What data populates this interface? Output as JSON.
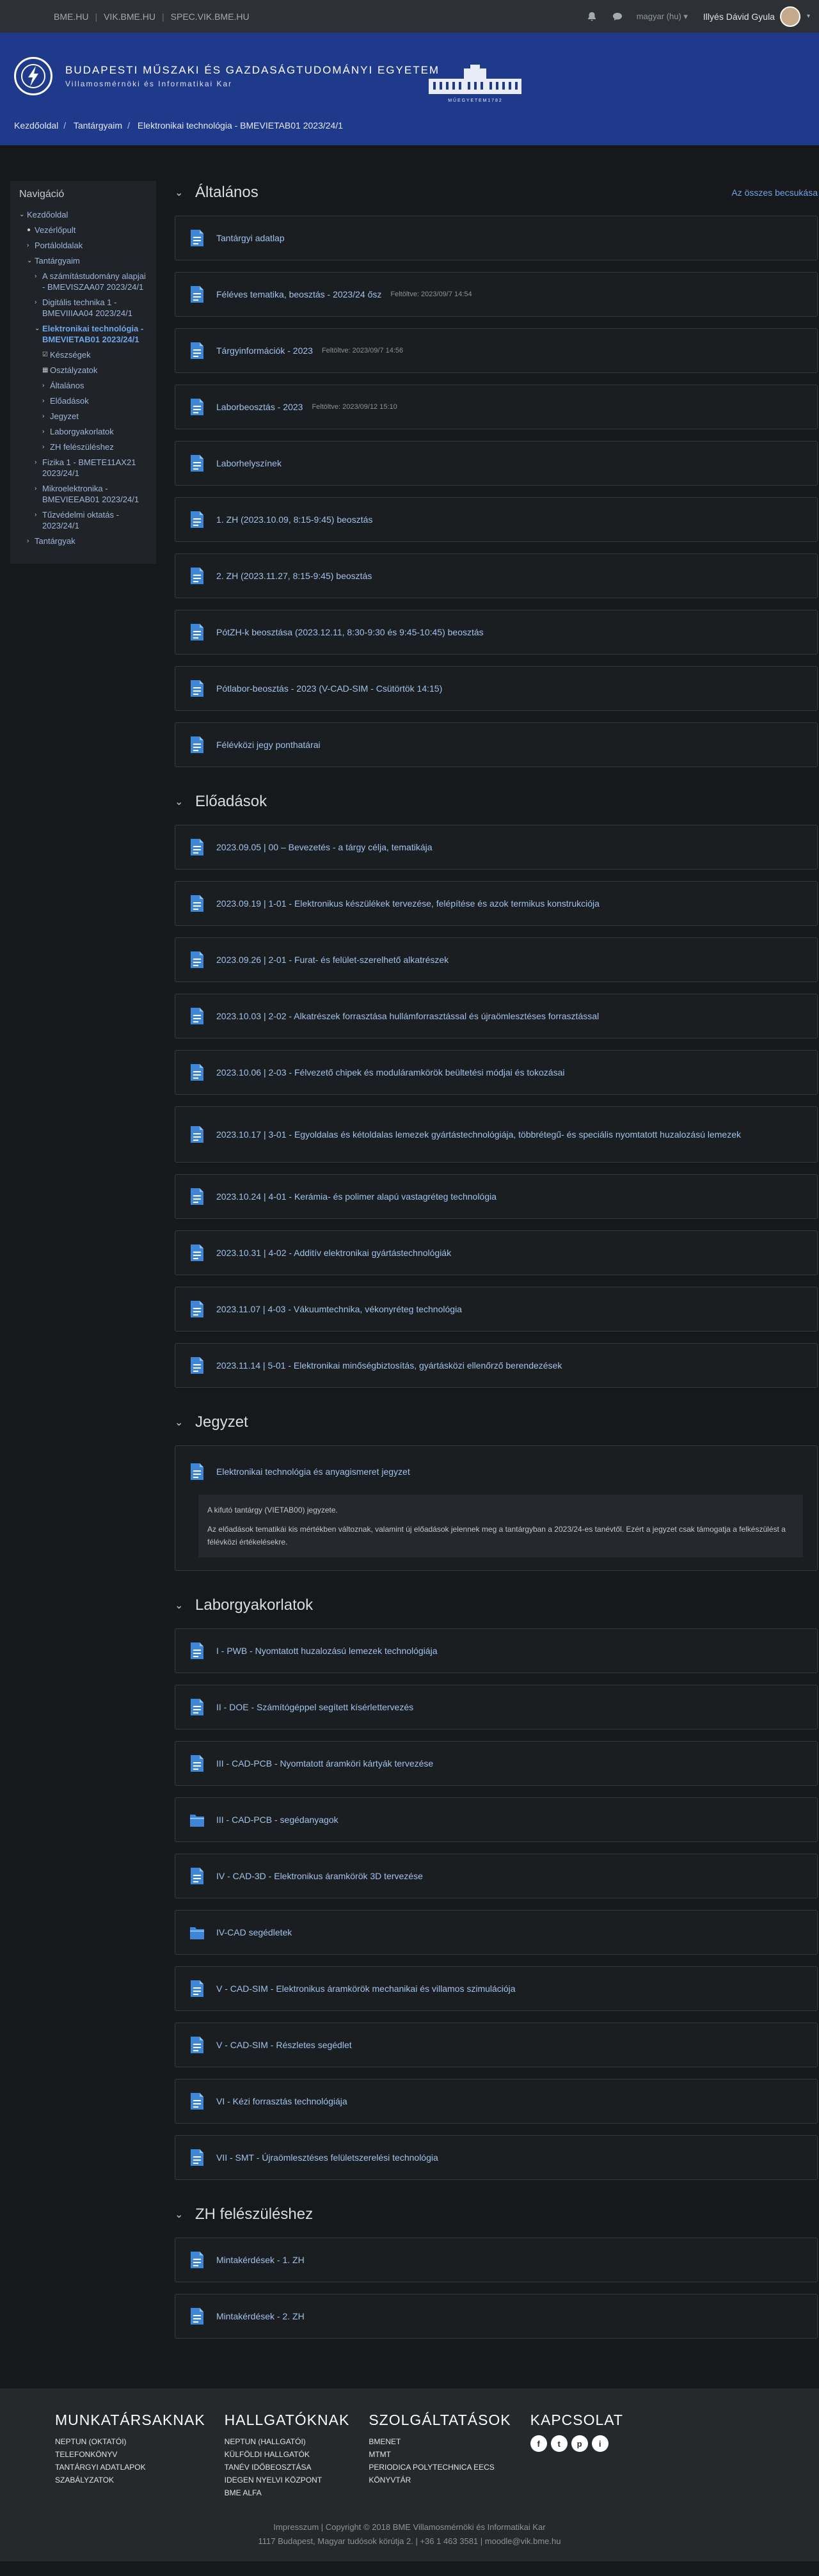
{
  "topbar": {
    "links": [
      "BME.HU",
      "VIK.BME.HU",
      "SPEC.VIK.BME.HU"
    ],
    "lang": "magyar (hu)",
    "user": "Illyés Dávid Gyula"
  },
  "banner": {
    "name1": "BUDAPESTI MŰSZAKI ÉS GAZDASÁGTUDOMÁNYI EGYETEM",
    "name2": "Villamosmérnöki és Informatikai Kar",
    "building_caption": "M Ű E G Y E T E M   1 7 8 2"
  },
  "breadcrumb": [
    "Kezdőoldal",
    "Tantárgyaim",
    "Elektronikai technológia - BMEVIETAB01 2023/24/1"
  ],
  "sidebar": {
    "title": "Navigáció",
    "items": [
      {
        "label": "Kezdőoldal",
        "indent": 0,
        "caret": "v"
      },
      {
        "label": "Vezérlőpult",
        "indent": 1,
        "caret": "o"
      },
      {
        "label": "Portáloldalak",
        "indent": 1,
        "caret": ">"
      },
      {
        "label": "Tantárgyaim",
        "indent": 1,
        "caret": "v"
      },
      {
        "label": "A számítástudomány alapjai - BMEVISZAA07 2023/24/1",
        "indent": 2,
        "caret": ">"
      },
      {
        "label": "Digitális technika 1 - BMEVIIIAA04 2023/24/1",
        "indent": 2,
        "caret": ">"
      },
      {
        "label": "Elektronikai technológia - BMEVIETAB01 2023/24/1",
        "indent": 2,
        "caret": "v",
        "active": true
      },
      {
        "label": "Készségek",
        "indent": 3,
        "caret": "k"
      },
      {
        "label": "Osztályzatok",
        "indent": 3,
        "caret": "g"
      },
      {
        "label": "Általános",
        "indent": 3,
        "caret": ">"
      },
      {
        "label": "Előadások",
        "indent": 3,
        "caret": ">"
      },
      {
        "label": "Jegyzet",
        "indent": 3,
        "caret": ">"
      },
      {
        "label": "Laborgyakorlatok",
        "indent": 3,
        "caret": ">"
      },
      {
        "label": "ZH felészüléshez",
        "indent": 3,
        "caret": ">"
      },
      {
        "label": "Fizika 1 - BMETE11AX21 2023/24/1",
        "indent": 2,
        "caret": ">"
      },
      {
        "label": "Mikroelektronika - BMEVIEEAB01 2023/24/1",
        "indent": 2,
        "caret": ">"
      },
      {
        "label": "Tűzvédelmi oktatás - 2023/24/1",
        "indent": 2,
        "caret": ">"
      },
      {
        "label": "Tantárgyak",
        "indent": 1,
        "caret": ">"
      }
    ]
  },
  "sections": {
    "general": {
      "title": "Általános",
      "collapse_all": "Az összes becsukása",
      "items": [
        {
          "label": "Tantárgyi adatlap",
          "updated": ""
        },
        {
          "label": "Féléves tematika, beosztás - 2023/24 ősz",
          "updated": "Feltöltve: 2023/09/7 14:54"
        },
        {
          "label": "Tárgyinformációk - 2023",
          "updated": "Feltöltve: 2023/09/7 14:56"
        },
        {
          "label": "Laborbeosztás - 2023",
          "updated": "Feltöltve: 2023/09/12 15:10"
        },
        {
          "label": "Laborhelyszínek",
          "updated": ""
        },
        {
          "label": "1. ZH (2023.10.09, 8:15-9:45) beosztás",
          "updated": ""
        },
        {
          "label": "2. ZH (2023.11.27, 8:15-9:45) beosztás",
          "updated": ""
        },
        {
          "label": "PótZH-k beosztása (2023.12.11, 8:30-9:30 és 9:45-10:45) beosztás",
          "updated": ""
        },
        {
          "label": "Pótlabor-beosztás - 2023 (V-CAD-SIM - Csütörtök 14:15)",
          "updated": ""
        },
        {
          "label": "Félévközi jegy ponthatárai",
          "updated": ""
        }
      ]
    },
    "lectures": {
      "title": "Előadások",
      "items": [
        "2023.09.05 | 00 – Bevezetés - a tárgy célja, tematikája",
        "2023.09.19 | 1-01 - Elektronikus készülékek tervezése, felépítése és azok termikus konstrukciója",
        "2023.09.26 | 2-01 - Furat- és felület-szerelhető alkatrészek",
        "2023.10.03 | 2-02 - Alkatrészek forrasztása hullámforrasztással és újraömlesztéses forrasztással",
        "2023.10.06 | 2-03 - Félvezető chipek és moduláramkörök beültetési módjai és tokozásai",
        "2023.10.17 | 3-01 - Egyoldalas és kétoldalas lemezek gyártástechnológiája, többrétegű- és speciális nyomtatott huzalozású lemezek",
        "2023.10.24 | 4-01 - Kerámia- és polimer alapú vastagréteg technológia",
        "2023.10.31 | 4-02 - Additív elektronikai gyártástechnológiák",
        "2023.11.07 | 4-03 - Vákuumtechnika, vékonyréteg technológia",
        "2023.11.14 | 5-01 - Elektronikai minőségbiztosítás, gyártásközi ellenőrző berendezések"
      ]
    },
    "notes": {
      "title": "Jegyzet",
      "item": "Elektronikai technológia és anyagismeret jegyzet",
      "p1": "A kifutó tantárgy (VIETAB00) jegyzete.",
      "p2": "Az előadások tematikái kis mértékben változnak, valamint új előadások jelennek meg a tantárgyban a 2023/24-es tanévtől. Ezért a jegyzet csak támogatja a felkészülést a félévközi értékelésekre."
    },
    "labs": {
      "title": "Laborgyakorlatok",
      "items": [
        {
          "label": "I - PWB - Nyomtatott huzalozású lemezek technológiája",
          "folder": false
        },
        {
          "label": "II - DOE - Számítógéppel segített kísérlettervezés",
          "folder": false
        },
        {
          "label": "III - CAD-PCB - Nyomtatott áramköri kártyák tervezése",
          "folder": false
        },
        {
          "label": "III - CAD-PCB - segédanyagok",
          "folder": true
        },
        {
          "label": "IV - CAD-3D - Elektronikus áramkörök 3D tervezése",
          "folder": false
        },
        {
          "label": "IV-CAD segédletek",
          "folder": true
        },
        {
          "label": "V - CAD-SIM - Elektronikus áramkörök mechanikai és villamos szimulációja",
          "folder": false
        },
        {
          "label": "V - CAD-SIM - Részletes segédlet",
          "folder": false
        },
        {
          "label": "VI - Kézi forrasztás technológiája",
          "folder": false
        },
        {
          "label": "VII - SMT - Újraömlesztéses felületszerelési technológia",
          "folder": false
        }
      ]
    },
    "zh": {
      "title": "ZH felészüléshez",
      "items": [
        "Mintakérdések - 1. ZH",
        "Mintakérdések - 2. ZH"
      ]
    }
  },
  "footer": {
    "cols": [
      {
        "title": "MUNKATÁRSAKNAK",
        "links": [
          "NEPTUN (OKTATÓI)",
          "TELEFONKÖNYV",
          "TANTÁRGYI ADATLAPOK",
          "SZABÁLYZATOK"
        ]
      },
      {
        "title": "HALLGATÓKNAK",
        "links": [
          "NEPTUN (HALLGATÓI)",
          "KÜLFÖLDI HALLGATÓK",
          "TANÉV IDŐBEOSZTÁSA",
          "IDEGEN NYELVI KÖZPONT",
          "BME ALFA"
        ]
      },
      {
        "title": "SZOLGÁLTATÁSOK",
        "links": [
          "BMENET",
          "MTMT",
          "PERIODICA POLYTECHNICA EECS",
          "KÖNYVTÁR"
        ]
      },
      {
        "title": "KAPCSOLAT",
        "links": []
      }
    ],
    "social": [
      "f",
      "t",
      "p",
      "i"
    ],
    "line1": "Impresszum | Copyright © 2018 BME Villamosmérnöki és Informatikai Kar",
    "line2": "1117 Budapest, Magyar tudósok körútja 2. | +36 1 463 3581 | moodle@vik.bme.hu"
  },
  "colors": {
    "accent": "#6fa5e8",
    "file_icon": "#3f86d6",
    "banner": "#1f3a8a"
  }
}
